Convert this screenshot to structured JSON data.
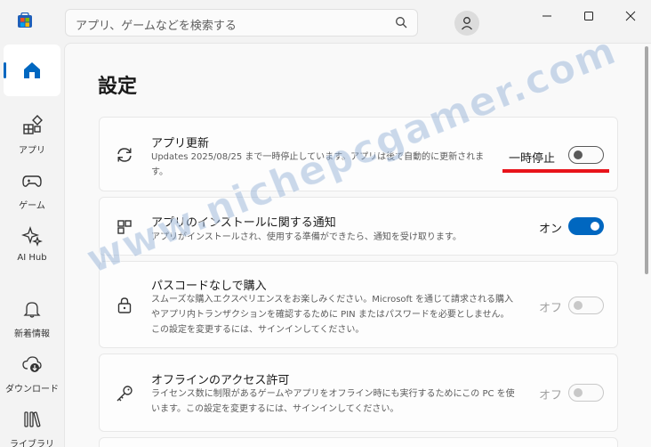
{
  "search": {
    "placeholder": "アプリ、ゲームなどを検索する"
  },
  "nav": {
    "items": [
      {
        "label": ""
      },
      {
        "label": "アプリ"
      },
      {
        "label": "ゲーム"
      },
      {
        "label": "AI Hub"
      },
      {
        "label": "新着情報"
      },
      {
        "label": "ダウンロード"
      },
      {
        "label": "ライブラリ"
      }
    ]
  },
  "page": {
    "title": "設定"
  },
  "settings": [
    {
      "title": "アプリ更新",
      "description": "Updates 2025/08/25 まで一時停止しています。アプリは後で自動的に更新されます。",
      "state": "一時停止",
      "toggle_on": false,
      "enabled": true,
      "icon": "refresh-icon"
    },
    {
      "title": "アプリのインストールに関する通知",
      "description": "アプリがインストールされ、使用する準備ができたら、通知を受け取ります。",
      "state": "オン",
      "toggle_on": true,
      "enabled": true,
      "icon": "apps-grid-icon"
    },
    {
      "title": "パスコードなしで購入",
      "description": "スムーズな購入エクスペリエンスをお楽しみください。Microsoft を通じて請求される購入やアプリ内トランザクションを確認するために PIN またはパスワードを必要としません。この設定を変更するには、サインインしてください。",
      "state": "オフ",
      "toggle_on": false,
      "enabled": false,
      "icon": "lock-icon"
    },
    {
      "title": "オフラインのアクセス許可",
      "description": "ライセンス数に制限があるゲームやアプリをオフライン時にも実行するためにこの PC を使います。この設定を変更するには、サインインしてください。",
      "state": "オフ",
      "toggle_on": false,
      "enabled": false,
      "icon": "key-icon"
    }
  ],
  "watermark": "www.nichepcgamer.com",
  "colors": {
    "accent": "#0067c0",
    "highlight_mark": "#e8141b"
  }
}
